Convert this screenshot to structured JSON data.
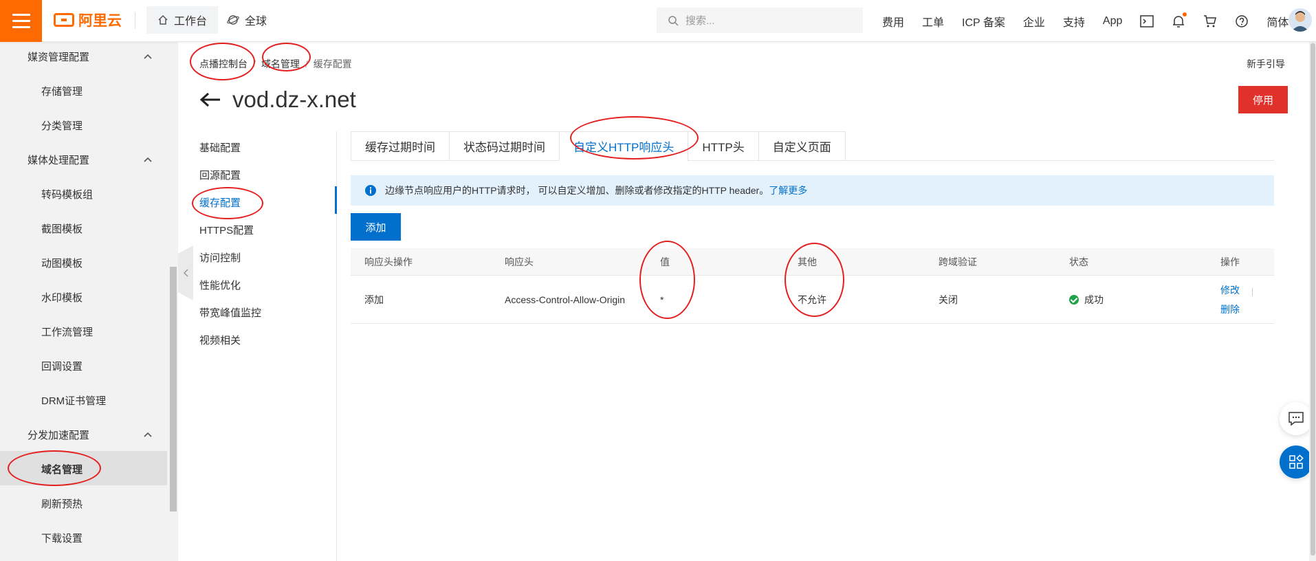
{
  "topbar": {
    "brand": "阿里云",
    "workbench": "工作台",
    "region": "全球",
    "search_placeholder": "搜索...",
    "nav": [
      "费用",
      "工单",
      "ICP 备案",
      "企业",
      "支持",
      "App"
    ],
    "language": "简体"
  },
  "sidebar": {
    "groups": [
      {
        "label": "媒资管理配置",
        "items": [
          "存储管理",
          "分类管理"
        ]
      },
      {
        "label": "媒体处理配置",
        "items": [
          "转码模板组",
          "截图模板",
          "动图模板",
          "水印模板",
          "工作流管理",
          "回调设置",
          "DRM证书管理"
        ]
      },
      {
        "label": "分发加速配置",
        "items": [
          "域名管理",
          "刷新预热",
          "下载设置"
        ]
      }
    ],
    "active_item": "域名管理"
  },
  "breadcrumb": [
    "点播控制台",
    "域名管理",
    "缓存配置"
  ],
  "guide_link": "新手引导",
  "page": {
    "title": "vod.dz-x.net",
    "stop_button": "停用"
  },
  "subnav": {
    "items": [
      "基础配置",
      "回源配置",
      "缓存配置",
      "HTTPS配置",
      "访问控制",
      "性能优化",
      "带宽峰值监控",
      "视频相关"
    ],
    "active": "缓存配置"
  },
  "tabs": {
    "items": [
      "缓存过期时间",
      "状态码过期时间",
      "自定义HTTP响应头",
      "HTTP头",
      "自定义页面"
    ],
    "active": "自定义HTTP响应头"
  },
  "notice": {
    "text": "边缘节点响应用户的HTTP请求时， 可以自定义增加、删除或者修改指定的HTTP header。",
    "more": "了解更多"
  },
  "add_button": "添加",
  "table": {
    "headers": [
      "响应头操作",
      "响应头",
      "值",
      "其他",
      "跨域验证",
      "状态",
      "操作"
    ],
    "rows": [
      {
        "op": "添加",
        "header": "Access-Control-Allow-Origin",
        "value": "*",
        "other": "不允许",
        "cors": "关闭",
        "status": "成功",
        "actions": [
          "修改",
          "删除"
        ]
      }
    ]
  },
  "colors": {
    "brand_orange": "#ff6a00",
    "link_blue": "#0070cc",
    "danger_red": "#e0312b",
    "success_green": "#21a148",
    "annotation_red": "#e41f1f"
  }
}
